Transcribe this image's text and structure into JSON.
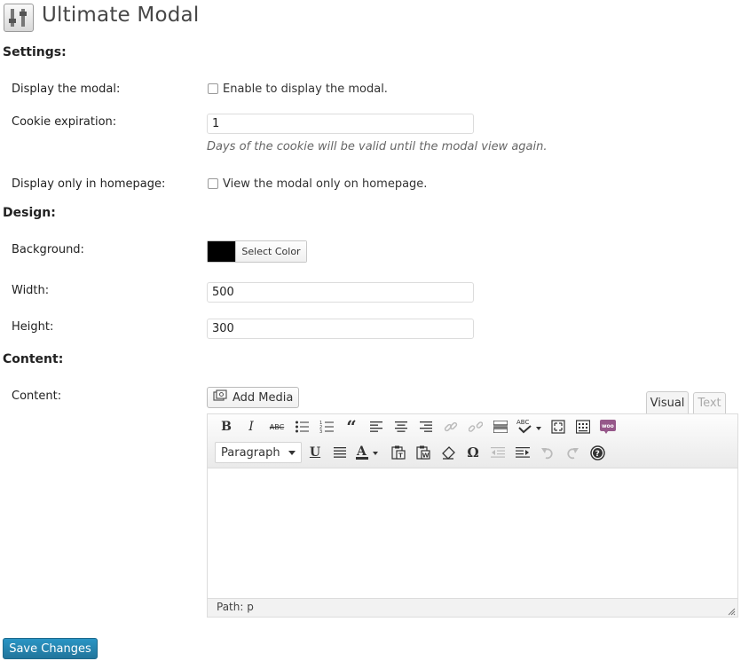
{
  "page": {
    "title": "Ultimate Modal"
  },
  "sections": {
    "settings": "Settings:",
    "design": "Design:",
    "content": "Content:"
  },
  "settings": {
    "display_modal": {
      "label": "Display the modal:",
      "checkbox_label": "Enable to display the modal.",
      "checked": false
    },
    "cookie": {
      "label": "Cookie expiration:",
      "value": "1",
      "description": "Days of the cookie will be valid until the modal view again."
    },
    "homepage": {
      "label": "Display only in homepage:",
      "checkbox_label": "View the modal only on homepage.",
      "checked": false
    }
  },
  "design": {
    "background": {
      "label": "Background:",
      "color": "#000000",
      "button": "Select Color"
    },
    "width": {
      "label": "Width:",
      "value": "500"
    },
    "height": {
      "label": "Height:",
      "value": "300"
    }
  },
  "content": {
    "label": "Content:",
    "add_media": "Add Media",
    "tabs": {
      "visual": "Visual",
      "text": "Text"
    },
    "toolbar_row1": [
      "bold-icon",
      "italic-icon",
      "strikethrough-icon",
      "bullet-list-icon",
      "numbered-list-icon",
      "blockquote-icon",
      "align-left-icon",
      "align-center-icon",
      "align-right-icon",
      "link-icon",
      "unlink-icon",
      "read-more-icon",
      "spellcheck-icon",
      "fullscreen-icon",
      "kitchen-sink-icon",
      "woo-icon"
    ],
    "toolbar_row2": [
      "underline-icon",
      "justify-icon",
      "text-color-icon",
      "paste-text-icon",
      "paste-word-icon",
      "clear-format-icon",
      "special-char-icon",
      "outdent-icon",
      "indent-icon",
      "undo-icon",
      "redo-icon",
      "help-icon"
    ],
    "format_select": "Paragraph",
    "path": "Path: p"
  },
  "actions": {
    "save": "Save Changes"
  },
  "colors": {
    "primary_button": "#21759b",
    "woo": "#96588a"
  }
}
